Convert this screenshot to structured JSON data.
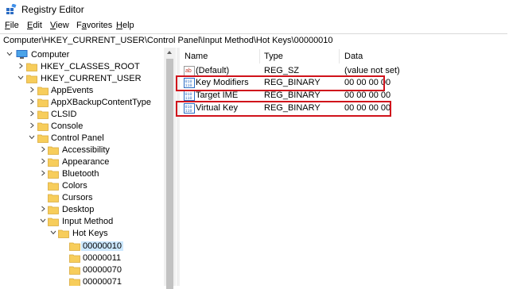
{
  "window": {
    "title": "Registry Editor"
  },
  "menu": [
    {
      "pre": "",
      "ul": "F",
      "post": "ile"
    },
    {
      "pre": "",
      "ul": "E",
      "post": "dit"
    },
    {
      "pre": "",
      "ul": "V",
      "post": "iew"
    },
    {
      "pre": "F",
      "ul": "a",
      "post": "vorites"
    },
    {
      "pre": "",
      "ul": "H",
      "post": "elp"
    }
  ],
  "address": {
    "path": "Computer\\HKEY_CURRENT_USER\\Control Panel\\Input Method\\Hot Keys\\00000010"
  },
  "tree": {
    "computer": "Computer",
    "hkcr": "HKEY_CLASSES_ROOT",
    "hkcu": "HKEY_CURRENT_USER",
    "appevents": "AppEvents",
    "appx": "AppXBackupContentType",
    "clsid": "CLSID",
    "console": "Console",
    "control_panel": "Control Panel",
    "accessibility": "Accessibility",
    "appearance": "Appearance",
    "bluetooth": "Bluetooth",
    "colors": "Colors",
    "cursors": "Cursors",
    "desktop": "Desktop",
    "input_method": "Input Method",
    "hot_keys": "Hot Keys",
    "k10": "00000010",
    "k11": "00000011",
    "k70": "00000070",
    "k71": "00000071"
  },
  "list": {
    "headers": {
      "name": "Name",
      "type": "Type",
      "data": "Data"
    },
    "rows": [
      {
        "name": "(Default)",
        "type": "REG_SZ",
        "data": "(value not set)",
        "icon": "string-value-icon"
      },
      {
        "name": "Key Modifiers",
        "type": "REG_BINARY",
        "data": "00 00 00 00",
        "icon": "binary-value-icon"
      },
      {
        "name": "Target IME",
        "type": "REG_BINARY",
        "data": "00 00 00 00",
        "icon": "binary-value-icon"
      },
      {
        "name": "Virtual Key",
        "type": "REG_BINARY",
        "data": "00 00 00 00",
        "icon": "binary-value-icon"
      }
    ]
  },
  "colors": {
    "highlight": "#d0121b",
    "selection": "#cce8ff",
    "folder": "#f7cd5b"
  }
}
